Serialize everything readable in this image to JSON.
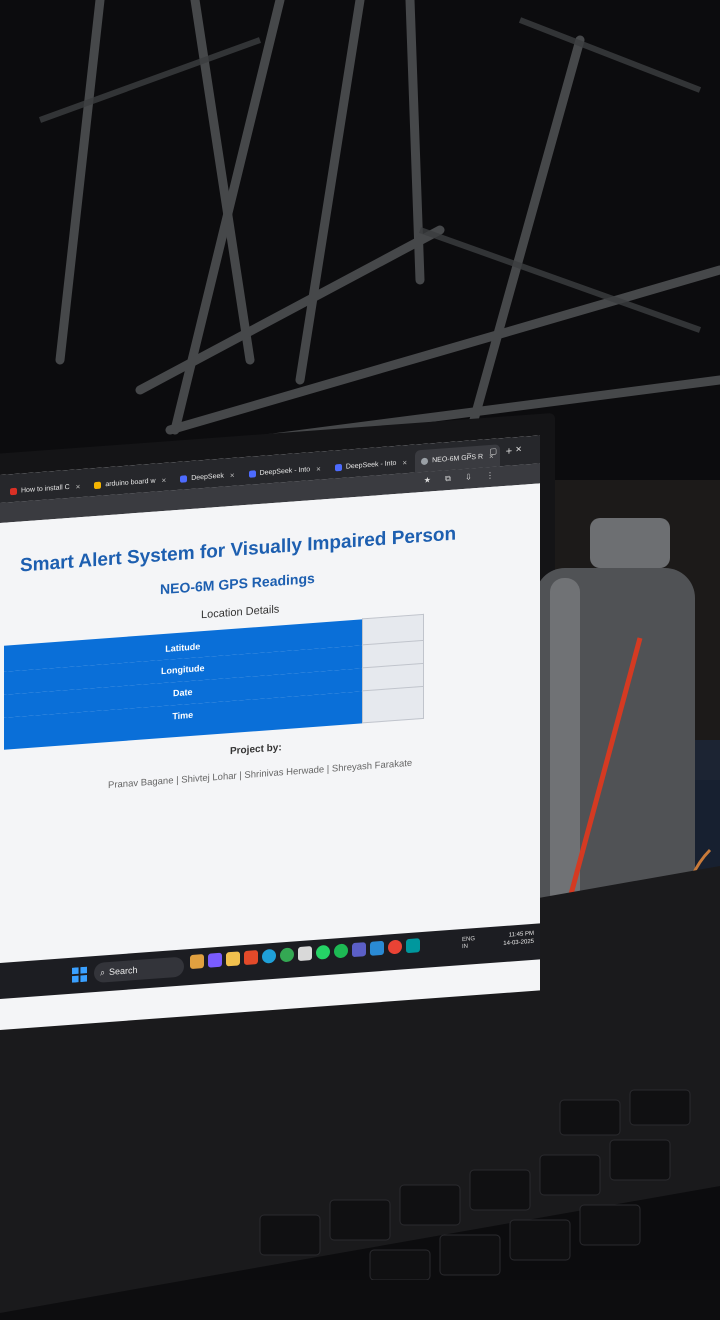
{
  "browser": {
    "tabs": [
      {
        "label": "How to install C",
        "active": false,
        "color": "#d93025"
      },
      {
        "label": "arduino board w",
        "active": false,
        "color": "#f4b400"
      },
      {
        "label": "DeepSeek",
        "active": false,
        "color": "#4d6bfe"
      },
      {
        "label": "DeepSeek - Into",
        "active": false,
        "color": "#4d6bfe"
      },
      {
        "label": "DeepSeek - Into",
        "active": false,
        "color": "#4d6bfe"
      },
      {
        "label": "NEO-6M GPS R",
        "active": true,
        "color": "#9aa0a6"
      }
    ],
    "new_tab": "+",
    "window_controls": "– ▢ ✕"
  },
  "page": {
    "title": "Smart Alert System for Visually Impaired Person",
    "subtitle": "NEO-6M GPS Readings",
    "section_heading": "Location Details",
    "rows": [
      {
        "label": "Latitude",
        "value": ""
      },
      {
        "label": "Longitude",
        "value": ""
      },
      {
        "label": "Date",
        "value": ""
      },
      {
        "label": "Time",
        "value": ""
      }
    ],
    "project_label": "Project by:",
    "authors": "Pranav Bagane | Shivtej Lohar | Shrinivas Herwade | Shreyash Farakate"
  },
  "taskbar": {
    "search_label": "Search",
    "language": "ENG\nIN",
    "time": "11:45 PM",
    "date": "14-03-2025"
  },
  "colors": {
    "accent": "#1d5fb0",
    "table_blue": "#0a6fd8"
  }
}
